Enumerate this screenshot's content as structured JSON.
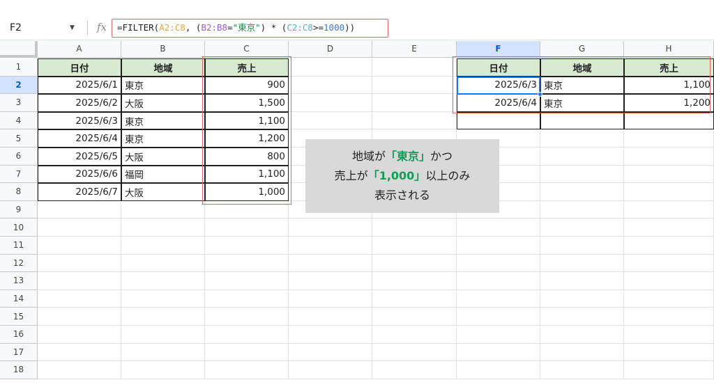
{
  "formula_bar": {
    "cell_ref": "F2",
    "fx": "fx",
    "formula_parts": [
      {
        "text": "=FILTER(",
        "color": "default"
      },
      {
        "text": "A2:C8",
        "color": "orange"
      },
      {
        "text": ", (",
        "color": "default"
      },
      {
        "text": "B2:B8",
        "color": "purple"
      },
      {
        "text": "=",
        "color": "default"
      },
      {
        "text": "\"東京\"",
        "color": "green"
      },
      {
        "text": ") * (",
        "color": "default"
      },
      {
        "text": "C2:C8",
        "color": "cyan"
      },
      {
        "text": ">=",
        "color": "default"
      },
      {
        "text": "1000",
        "color": "blue"
      },
      {
        "text": "))",
        "color": "default"
      }
    ]
  },
  "columns": [
    "A",
    "B",
    "C",
    "D",
    "E",
    "F",
    "G",
    "H"
  ],
  "selected_column": "F",
  "rows": [
    "1",
    "2",
    "3",
    "4",
    "5",
    "6",
    "7",
    "8",
    "9",
    "10",
    "11",
    "12",
    "13",
    "14",
    "15",
    "16",
    "17",
    "18"
  ],
  "selected_row": "2",
  "source_table": {
    "headers": [
      "日付",
      "地域",
      "売上"
    ],
    "rows": [
      [
        "2025/6/1",
        "東京",
        "900"
      ],
      [
        "2025/6/2",
        "大阪",
        "1,500"
      ],
      [
        "2025/6/3",
        "東京",
        "1,100"
      ],
      [
        "2025/6/4",
        "東京",
        "1,200"
      ],
      [
        "2025/6/5",
        "大阪",
        "800"
      ],
      [
        "2025/6/6",
        "福岡",
        "1,100"
      ],
      [
        "2025/6/7",
        "大阪",
        "1,000"
      ]
    ]
  },
  "result_table": {
    "headers": [
      "日付",
      "地域",
      "売上"
    ],
    "rows": [
      [
        "2025/6/3",
        "東京",
        "1,100"
      ],
      [
        "2025/6/4",
        "東京",
        "1,200"
      ],
      [
        "",
        "",
        ""
      ]
    ]
  },
  "callout": {
    "line1_a": "地域が",
    "line1_b": "「東京」",
    "line1_c": "かつ",
    "line2_a": "売上が",
    "line2_b": "「1,000」",
    "line2_c": "以上のみ",
    "line3": "表示される"
  },
  "colors": {
    "header_fill": "#d9ead3",
    "highlight_border": "#e06666",
    "selection": "#1a73e8",
    "callout_bg": "#d9d9d9",
    "callout_accent": "#0f9d58"
  }
}
